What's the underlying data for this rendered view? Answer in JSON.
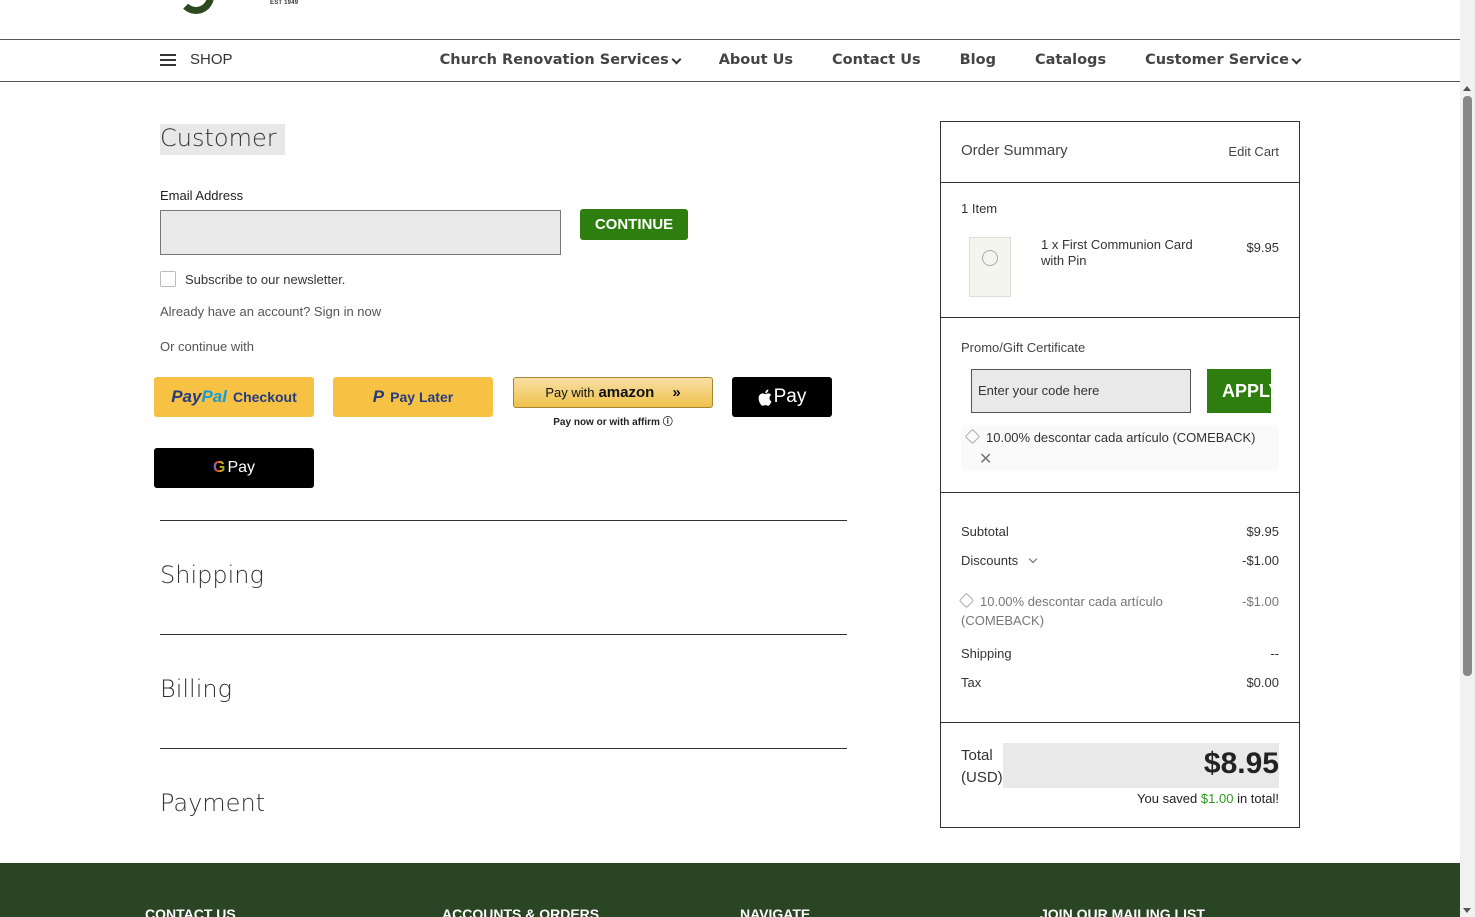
{
  "header": {
    "logo_est": "EST 1949"
  },
  "nav": {
    "shop_label": "SHOP",
    "links": [
      "Church Renovation Services",
      "About Us",
      "Contact Us",
      "Blog",
      "Catalogs",
      "Customer Service"
    ]
  },
  "customer": {
    "title": "Customer",
    "email_label": "Email Address",
    "email_value": "",
    "continue_label": "CONTINUE",
    "newsletter_label": "Subscribe to our newsletter.",
    "signin_text": "Already have an account? Sign in now",
    "or_continue": "Or continue with"
  },
  "payment_buttons": {
    "paypal_logo_a": "Pay",
    "paypal_logo_b": "Pal",
    "paypal_text": "Checkout",
    "paylater_text": "Pay Later",
    "amazon_prefix": "Pay with",
    "amazon_logo": "amazon",
    "amazon_note": "Pay now or with affirm ⓘ",
    "applepay_text": "Pay",
    "gpay_text": "Pay"
  },
  "sections": {
    "shipping": "Shipping",
    "billing": "Billing",
    "payment": "Payment"
  },
  "summary": {
    "title": "Order Summary",
    "edit_cart": "Edit Cart",
    "item_count": "1 Item",
    "item_name": "1 x First Communion Card with Pin",
    "item_price": "$9.95",
    "promo_label": "Promo/Gift Certificate",
    "promo_placeholder": "Enter your code here",
    "apply_label": "APPLY",
    "coupon_text": "10.00% descontar cada artículo (COMEBACK)",
    "subtotal_label": "Subtotal",
    "subtotal_value": "$9.95",
    "discounts_label": "Discounts",
    "discounts_value": "-$1.00",
    "discount_detail": "10.00% descontar cada artículo (COMEBACK)",
    "discount_detail_value": "-$1.00",
    "shipping_label": "Shipping",
    "shipping_value": "--",
    "tax_label": "Tax",
    "tax_value": "$0.00",
    "total_label": "Total (USD)",
    "total_value": "$8.95",
    "saved_prefix": "You saved",
    "saved_amount": "$1.00",
    "saved_suffix": "in total!"
  },
  "footer": {
    "columns": [
      "CONTACT US",
      "ACCOUNTS & ORDERS",
      "NAVIGATE",
      "JOIN OUR MAILING LIST"
    ]
  }
}
